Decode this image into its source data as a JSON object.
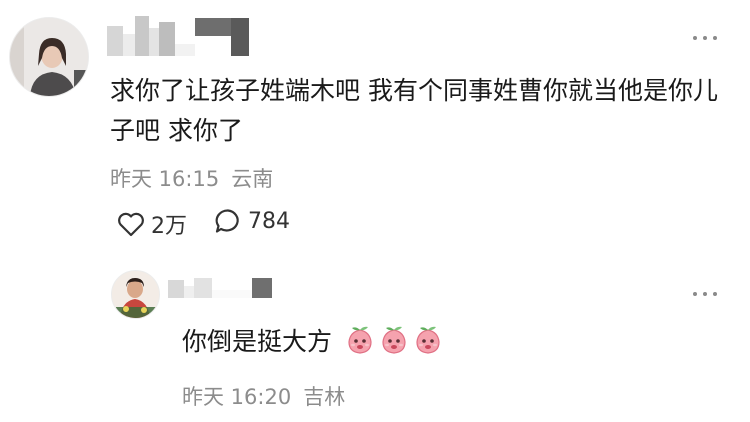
{
  "comment": {
    "text": "求你了让孩子姓端木吧 我有个同事姓曹你就当他是你儿子吧 求你了",
    "time": "昨天 16:15",
    "location": "云南",
    "likes": "2万",
    "replies": "784",
    "icons": [
      "heart-icon",
      "comment-bubble-icon",
      "more-dots-icon"
    ]
  },
  "reply": {
    "text": "你倒是挺大方",
    "emoji_count": 3,
    "emoji_name": "peach-emoji",
    "time": "昨天 16:20",
    "location": "吉林"
  },
  "colors": {
    "text": "#1a1a1a",
    "meta": "#8c8c8c",
    "emoji_pink": "#f28c9a",
    "emoji_green": "#7cc37a"
  }
}
